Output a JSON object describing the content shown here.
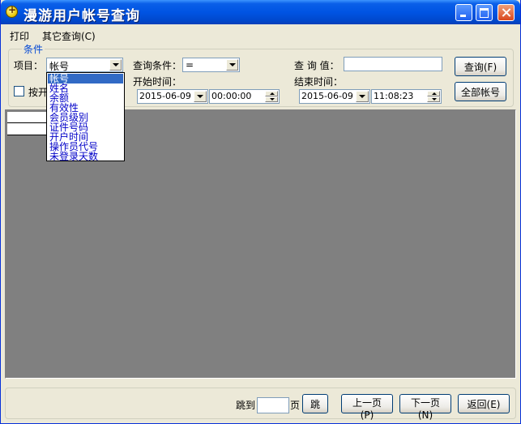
{
  "window": {
    "title": "漫游用户帐号查询"
  },
  "menu": {
    "items": [
      "打印",
      "其它查询(C)"
    ]
  },
  "conditions": {
    "legend": "条件",
    "item_label": "项目：",
    "item_value": "帐号",
    "query_condition_label": "查询条件：",
    "query_condition_value": "=",
    "query_value_label": "查 询 值：",
    "query_value": "",
    "checkbox_label": "按开",
    "start_time_label": "开始时间：",
    "start_date": "2015-06-09",
    "start_time": "00:00:00",
    "end_time_label": "结束时间：",
    "end_date": "2015-06-09",
    "end_time": "11:08:23",
    "query_button": "查询(F)",
    "all_accounts_button": "全部帐号"
  },
  "item_dropdown": {
    "options": [
      "帐号",
      "姓名",
      "余额",
      "有效性",
      "会员级别",
      "证件号码",
      "开户时间",
      "操作员代号",
      "未登录天数"
    ],
    "selected": 0
  },
  "pagination": {
    "jump_label": "跳到",
    "page_input": "",
    "page_label": "页",
    "jump_button": "跳",
    "prev_button": "上一页(P)",
    "next_button": "下一页(N)",
    "back_button": "返回(E)"
  }
}
